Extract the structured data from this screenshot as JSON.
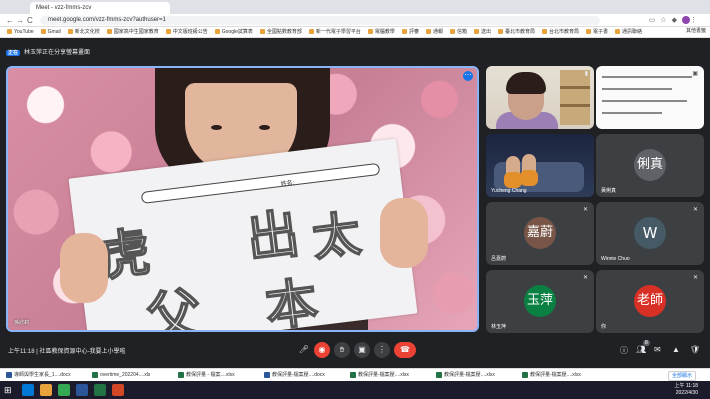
{
  "browser": {
    "tab_title": "Meet - vzz-fmms-zcv",
    "url": "meet.google.com/vzz-fmms-zcv?authuser=1",
    "nav_back": "←",
    "nav_forward": "→",
    "nav_reload": "C",
    "bookmarks": [
      "YouTube",
      "Gmail",
      "新北文化校",
      "國家高中生國家教育",
      "中文版班級公告",
      "Google試算表",
      "全國點數教育部",
      "新一代電子學習平台",
      "電腦教學",
      "評審",
      "通報",
      "信箱",
      "送出",
      "臺北市教育局",
      "台北市教育局",
      "電子書",
      "通訊聯絡"
    ],
    "bookmarks_other": "其他書籤"
  },
  "meet": {
    "presentation_badge": "正在",
    "presentation_text": "林玉萍正在分享螢幕畫面",
    "main_tile": {
      "name": "孫欣莉",
      "paper_name_label": "姓名:",
      "characters": [
        "虎",
        "出",
        "太",
        "父",
        "本"
      ]
    },
    "tiles": [
      {
        "name": "",
        "kind": "teacher-video"
      },
      {
        "name": "",
        "kind": "screen-share"
      },
      {
        "name": "Yucheng Chang",
        "kind": "video"
      },
      {
        "name": "黃俐真",
        "initials": "俐真",
        "color": "#5f6368"
      },
      {
        "name": "呂嘉蔚",
        "initials": "嘉蔚",
        "color": "#795548"
      },
      {
        "name": "Winnie Chuo",
        "initials": "W",
        "color": "#455a64"
      },
      {
        "name": "林玉萍",
        "initials": "玉萍",
        "color": "#0b8043"
      },
      {
        "name": "你",
        "initials": "老師",
        "color": "#d93025"
      }
    ],
    "bottom": {
      "time": "上午11:18",
      "separator": "|",
      "meeting_title": "社區教保資源中心-我要上小學啦",
      "people_count": "8"
    }
  },
  "downloads": {
    "items": [
      "導師與學生家長_1....docx",
      "overtime_202204....xls",
      "教保評量 - 檔案....xlsx",
      "教保評量-檔案壓....docx",
      "教保評量-檔案壓....xlsx",
      "教保評量-檔案壓....xlsx",
      "教保評量-檔案壓....xlsx"
    ],
    "show_all": "全部顯示"
  },
  "taskbar": {
    "time": "上午 11:18",
    "date": "2022/4/30"
  }
}
